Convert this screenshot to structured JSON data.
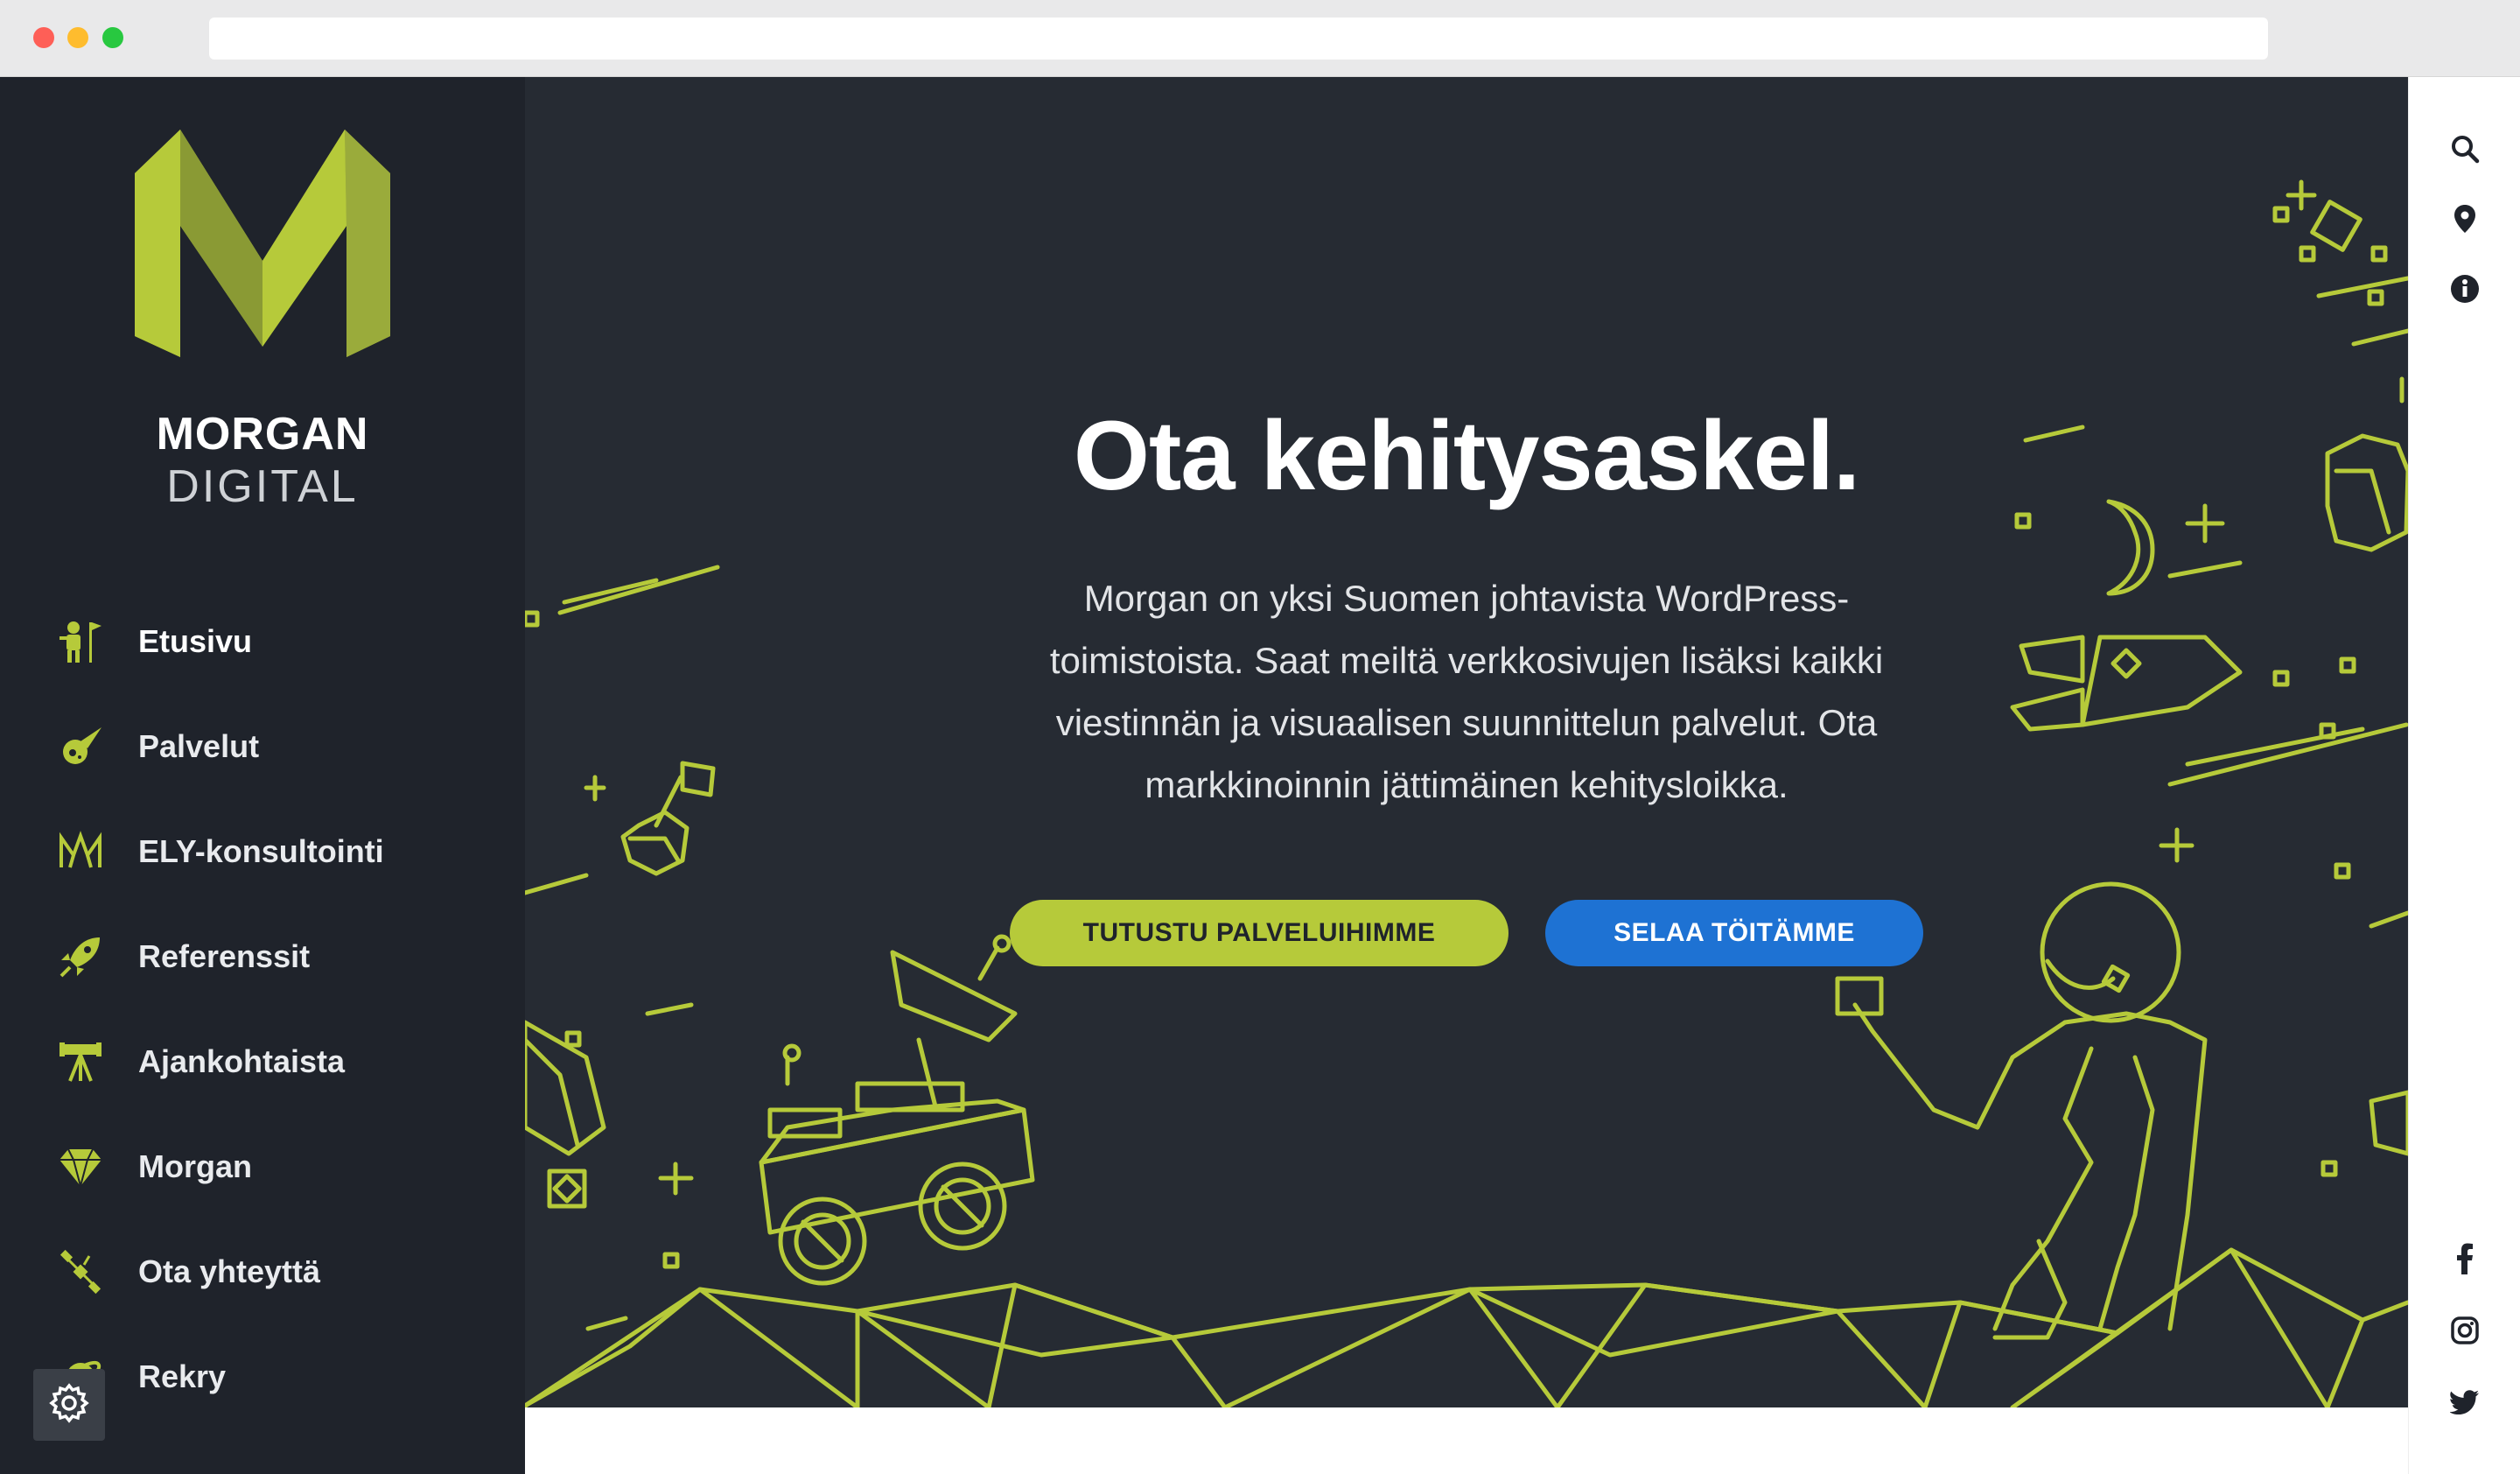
{
  "browser": {
    "address_value": ""
  },
  "brand": {
    "word1": "MORGAN",
    "word2": "DIGITAL",
    "accent": "#b6ca3a",
    "dark": "#1f232b"
  },
  "sidebar": {
    "items": [
      {
        "label": "Etusivu",
        "icon": "person-flag-icon",
        "active": true
      },
      {
        "label": "Palvelut",
        "icon": "comet-icon"
      },
      {
        "label": "ELY-konsultointi",
        "icon": "m-logo-icon"
      },
      {
        "label": "Referenssit",
        "icon": "rocket-icon"
      },
      {
        "label": "Ajankohtaista",
        "icon": "telescope-icon"
      },
      {
        "label": "Morgan",
        "icon": "diamond-icon"
      },
      {
        "label": "Ota yhteyttä",
        "icon": "satellite-icon"
      },
      {
        "label": "Rekry",
        "icon": "planet-icon"
      }
    ],
    "settings_icon": "gear-icon"
  },
  "hero": {
    "title": "Ota kehitysaskel.",
    "lines": [
      "Morgan on yksi Suomen johtavista WordPress-",
      "toimistoista. Saat meiltä verkkosivujen lisäksi kaikki",
      "viestinnän ja visuaalisen suunnittelun palvelut. Ota",
      "markkinoinnin jättimäinen kehitysloikka."
    ],
    "primary_button": "TUTUSTU PALVELUIHIMME",
    "secondary_button": "SELAA TÖITÄMME",
    "primary_color": "#b6ca3a",
    "secondary_color": "#1e72d3",
    "background": "#262b33"
  },
  "rail": {
    "top_icons": [
      "search-icon",
      "location-pin-icon",
      "info-icon"
    ],
    "social_icons": [
      "facebook-icon",
      "instagram-icon",
      "twitter-icon"
    ]
  }
}
